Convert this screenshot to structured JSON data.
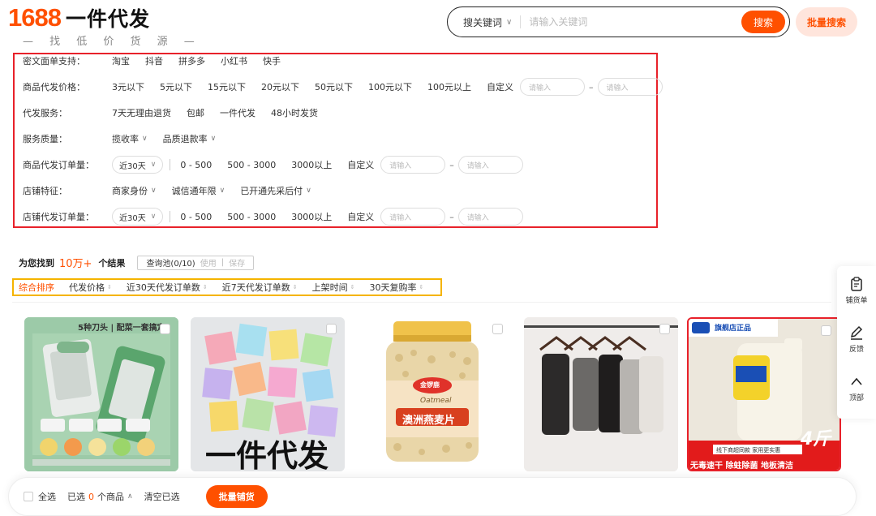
{
  "logo": {
    "number": "1688",
    "text": "一件代发",
    "slogan": "— 找 低 价 货 源 —"
  },
  "search": {
    "type_label": "搜关键词",
    "placeholder": "请输入关键词",
    "button": "搜索",
    "batch_button": "批量搜索"
  },
  "filters": {
    "platforms": {
      "label": "密文面单支持：",
      "options": [
        "淘宝",
        "抖音",
        "拼多多",
        "小红书",
        "快手"
      ]
    },
    "price": {
      "label": "商品代发价格：",
      "options": [
        "3元以下",
        "5元以下",
        "15元以下",
        "20元以下",
        "50元以下",
        "100元以下",
        "100元以上"
      ],
      "custom": "自定义",
      "min_placeholder": "请输入",
      "max_placeholder": "请输入"
    },
    "service": {
      "label": "代发服务：",
      "options": [
        "7天无理由退货",
        "包邮",
        "一件代发",
        "48小时发货"
      ]
    },
    "quality": {
      "label": "服务质量：",
      "options": [
        "揽收率",
        "品质退款率"
      ]
    },
    "product_orders": {
      "label": "商品代发订单量：",
      "period": "近30天",
      "options": [
        "0 - 500",
        "500 - 3000",
        "3000以上"
      ],
      "custom": "自定义",
      "min_placeholder": "请输入",
      "max_placeholder": "请输入"
    },
    "shop_features": {
      "label": "店铺特征：",
      "options": [
        "商家身份",
        "诚信通年限",
        "已开通先采后付"
      ]
    },
    "shop_orders": {
      "label": "店铺代发订单量：",
      "period": "近30天",
      "options": [
        "0 - 500",
        "500 - 3000",
        "3000以上"
      ],
      "custom": "自定义",
      "min_placeholder": "请输入",
      "max_placeholder": "请输入"
    }
  },
  "results": {
    "prefix": "为您找到",
    "count": "10万+",
    "suffix": "个结果",
    "pool": "查询池(0/10)",
    "use": "使用",
    "save": "保存"
  },
  "sort": {
    "items": [
      "综合排序",
      "代发价格",
      "近30天代发订单数",
      "近7天代发订单数",
      "上架时间",
      "30天复购率"
    ]
  },
  "products": [
    {
      "banner": "5种刀头 | 配菜一套搞定"
    },
    {
      "banner": "一件代发"
    },
    {
      "brand": "金锣鹿",
      "en": "Oatmeal",
      "name": "澳洲燕麦片"
    },
    {},
    {
      "tag": "旗舰店正品",
      "slogan": "线下商超同款 家用更实惠",
      "weight": "4斤",
      "bottom": "无毒速干 除蛀除菌 地板清洁"
    }
  ],
  "sidebar": {
    "items": [
      "铺货单",
      "反馈",
      "顶部"
    ]
  },
  "bottom": {
    "select_all": "全选",
    "selected_prefix": "已选",
    "selected_count": "0",
    "selected_suffix": "个商品",
    "clear": "清空已选",
    "button": "批量铺货"
  },
  "colors": {
    "accent": "#ff5000",
    "red_frame": "#e8212a",
    "yellow_frame": "#f5b400"
  }
}
